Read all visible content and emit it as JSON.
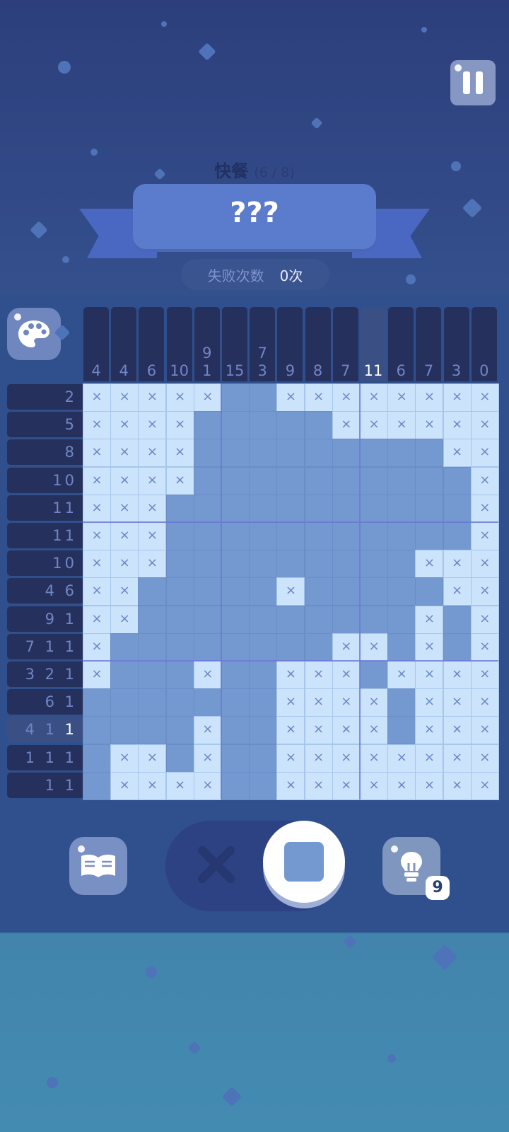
{
  "level": {
    "name": "快餐",
    "progress": "(6 / 8)",
    "title": "???"
  },
  "failures": {
    "label": "失败次数",
    "value": "0次"
  },
  "column_clues": [
    "4",
    "4",
    "6",
    "10",
    "9\n1",
    "15",
    "7\n3",
    "9",
    "8",
    "7",
    "11",
    "6",
    "7",
    "3",
    "0"
  ],
  "active_column": 10,
  "row_clues": [
    {
      "text": "2"
    },
    {
      "text": "5"
    },
    {
      "text": "8"
    },
    {
      "text": "10"
    },
    {
      "text": "11"
    },
    {
      "text": "11"
    },
    {
      "text": "10"
    },
    {
      "text": "4 6"
    },
    {
      "text": "9 1"
    },
    {
      "text": "7 1 1"
    },
    {
      "text": "3 2 1"
    },
    {
      "text": "6 1"
    },
    {
      "pre": "4 1 ",
      "hl": "1"
    },
    {
      "text": "1 1 1"
    },
    {
      "text": "1 1"
    }
  ],
  "active_row": 12,
  "grid": [
    "xxxxx..xxxxxxxx",
    "xxxx.....xxxxxx",
    "xxxx.........xx",
    "xxxx..........x",
    "xxx...........x",
    "xxx...........x",
    "xxx.........xxx",
    "xx.....x.....xx",
    "xx..........x.xx",
    "x........xx.x.xx",
    "x...x..xxx.xxxx",
    ".......xxxx.xxxx",
    "....x..xxxx.xxxx",
    ".xx.x..xxxxxxxx",
    ".xxxx..xxxxxxxx"
  ],
  "mark_glyph": "×",
  "hints_remaining": "9",
  "icons": {
    "pause": "pause-icon",
    "palette": "palette-icon",
    "book": "book-icon",
    "mode_cross": "cross-icon",
    "mode_fill": "fill-square-icon",
    "hint": "lightbulb-icon"
  },
  "colors": {
    "filled": "#7399d0",
    "marked": "#cbe3fb",
    "clue_bg": "#26305c",
    "clue_text": "#6f86c6"
  }
}
